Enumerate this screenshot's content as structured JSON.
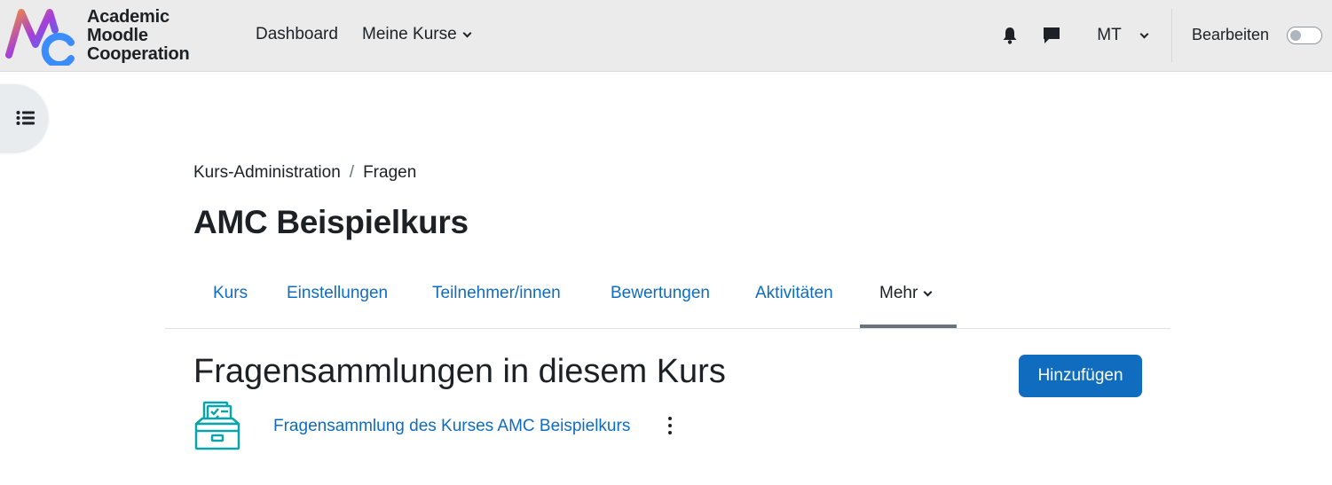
{
  "brand": {
    "line1": "Academic",
    "line2": "Moodle",
    "line3": "Cooperation",
    "colors": {
      "gradient_start": "#f28c3a",
      "gradient_mid": "#a63fd6",
      "gradient_end": "#2f7bff"
    }
  },
  "navbar": {
    "links": {
      "dashboard": "Dashboard",
      "my_courses": "Meine Kurse"
    },
    "icons": {
      "notifications": "bell-icon",
      "messages": "chat-icon"
    },
    "user_initials": "MT",
    "edit_mode_label": "Bearbeiten",
    "edit_mode_on": false
  },
  "breadcrumb": {
    "items": [
      "Kurs-Administration",
      "Fragen"
    ],
    "separator": "/"
  },
  "page": {
    "title": "AMC Beispielkurs"
  },
  "secondary_nav": {
    "tabs": [
      "Kurs",
      "Einstellungen",
      "Teilnehmer/innen",
      "Bewertungen",
      "Aktivitäten",
      "Mehr"
    ],
    "active_index": 5
  },
  "section": {
    "title": "Fragensammlungen in diesem Kurs",
    "add_button": "Hinzufügen",
    "items": [
      {
        "label": "Fragensammlung des Kurses AMC Beispielkurs",
        "icon": "question-bank-icon"
      }
    ]
  },
  "colors": {
    "link": "#0f6cbf",
    "primary": "#0f6cbf",
    "navbar_bg": "#ebebeb",
    "icon_teal": "#0aa4ad"
  }
}
